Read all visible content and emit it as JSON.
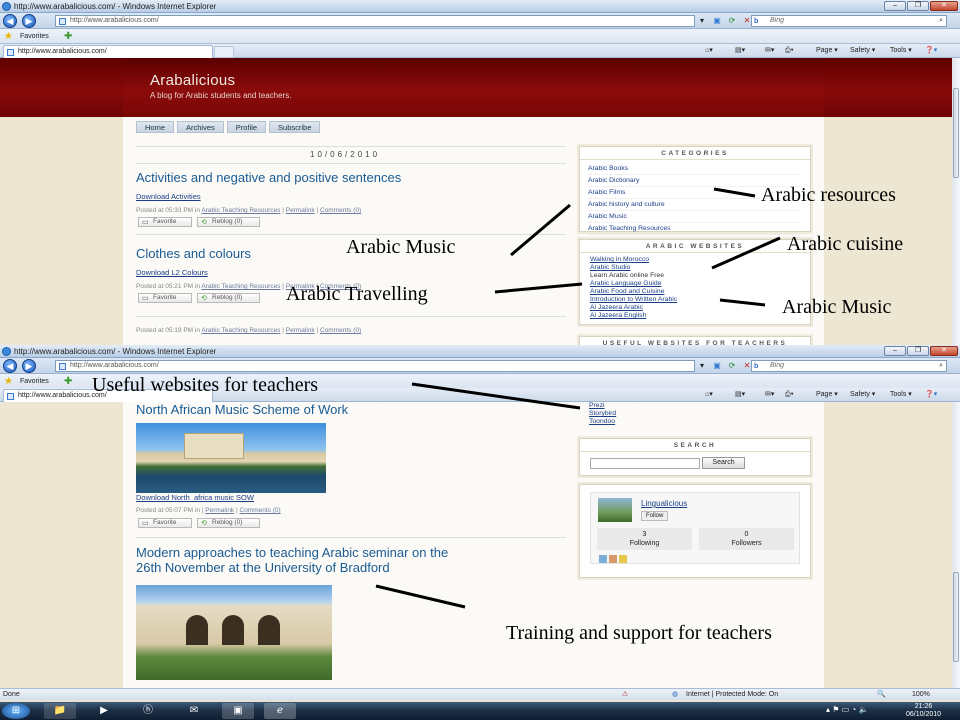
{
  "window": {
    "title": "http://www.arabalicious.com/ - Windows Internet Explorer",
    "url": "http://www.arabalicious.com/",
    "search_placeholder": "Bing",
    "favorites_label": "Favorites",
    "tab_label": "http://www.arabalicious.com/",
    "commands": {
      "page": "Page ▾",
      "safety": "Safety ▾",
      "tools": "Tools ▾"
    }
  },
  "blog": {
    "title": "Arabalicious",
    "subtitle": "A blog for Arabic students and teachers.",
    "menu": [
      "Home",
      "Archives",
      "Profile",
      "Subscribe"
    ],
    "date": "10/06/2010",
    "posts": [
      {
        "title": "Activities and negative and positive sentences",
        "link": "Download Activities",
        "posted": "Posted at 05:33 PM in",
        "category": "Arabic Teaching Resources",
        "permalink": "Permalink",
        "comments": "Comments (0)"
      },
      {
        "title": "Clothes and colours",
        "link": "Download L2 Colours",
        "posted": "Posted at 05:21 PM in",
        "category": "Arabic Teaching Resources",
        "permalink": "Permalink",
        "comments": "Comments (0)"
      }
    ],
    "post3_meta": {
      "posted": "Posted at 05:19 PM in",
      "category": "Arabic Teaching Resources",
      "permalink": "Permalink",
      "comments": "Comments (0)"
    },
    "favorite_label": "Favorite",
    "reblog_label": "Reblog (0)",
    "categories_heading": "CATEGORIES",
    "categories": [
      "Arabic Books",
      "Arabic Dictionary",
      "Arabic Films",
      "Arabic history and culture",
      "Arabic Music",
      "Arabic Teaching Resources"
    ],
    "websites_heading": "ARABIC WEBSITES",
    "websites": [
      "Walking in Morocco",
      "Arabic Studio",
      "Learn Arabic online Free",
      "Arabic Language Guide",
      "Arabic Food and Cuisine",
      "Introduction to Written Arabic",
      "Al Jazeera Arabic",
      "Al Jazeera English"
    ],
    "teachers_heading_partial": "USEFUL WEBSITES FOR TEACHERS"
  },
  "blog2": {
    "post_a": {
      "title": "North African Music Scheme of Work",
      "link": "Download North_africa music SOW",
      "posted": "Posted at 05:07 PM in",
      "permalink": "Permalink",
      "comments": "Comments (0)"
    },
    "post_b": {
      "title_line1": "Modern approaches to teaching Arabic seminar on the",
      "title_line2": "26th November at the University of Bradford"
    },
    "teacher_links": [
      "Prezi",
      "Storybird",
      "Toondoo"
    ],
    "search_heading": "SEARCH",
    "search_button": "Search",
    "tumblelog": {
      "name": "Lingualicious",
      "follow": "Follow",
      "following_count": "3",
      "following_label": "Following",
      "followers_count": "0",
      "followers_label": "Followers"
    }
  },
  "status": {
    "left": "Done",
    "zone": "Internet | Protected Mode: On",
    "zoom": "100%"
  },
  "taskbar": {
    "time": "21:26",
    "date": "06/10/2010"
  },
  "annotations": {
    "resources": "Arabic resources",
    "music_top": "Arabic Music",
    "cuisine": "Arabic cuisine",
    "travelling": "Arabic Travelling",
    "music_right": "Arabic Music",
    "teachers": "Useful websites for teachers",
    "training": "Training and support for teachers"
  }
}
